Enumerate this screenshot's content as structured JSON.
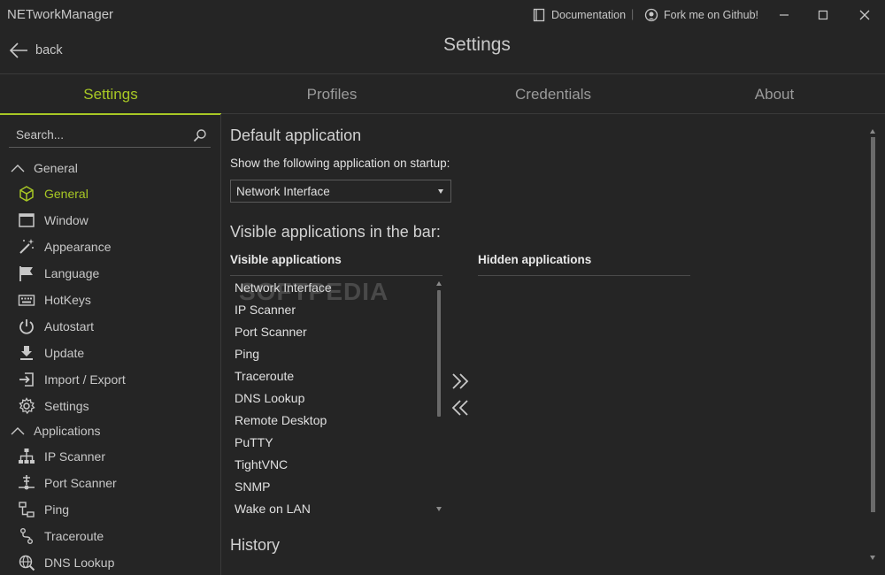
{
  "window": {
    "title": "NETworkManager",
    "documentation_label": "Documentation",
    "separator": "|",
    "github_label": "Fork me on Github!"
  },
  "header": {
    "back_label": "back",
    "title": "Settings"
  },
  "tabs": [
    {
      "label": "Settings",
      "active": true
    },
    {
      "label": "Profiles",
      "active": false
    },
    {
      "label": "Credentials",
      "active": false
    },
    {
      "label": "About",
      "active": false
    }
  ],
  "sidebar": {
    "search_placeholder": "Search...",
    "groups": [
      {
        "label": "General",
        "items": [
          {
            "label": "General",
            "icon": "cube-icon",
            "active": true
          },
          {
            "label": "Window",
            "icon": "window-icon"
          },
          {
            "label": "Appearance",
            "icon": "magic-wand-icon"
          },
          {
            "label": "Language",
            "icon": "flag-icon"
          },
          {
            "label": "HotKeys",
            "icon": "keyboard-icon"
          },
          {
            "label": "Autostart",
            "icon": "power-icon"
          },
          {
            "label": "Update",
            "icon": "download-icon"
          },
          {
            "label": "Import / Export",
            "icon": "import-icon"
          },
          {
            "label": "Settings",
            "icon": "gear-icon"
          }
        ]
      },
      {
        "label": "Applications",
        "items": [
          {
            "label": "IP Scanner",
            "icon": "network-tree-icon"
          },
          {
            "label": "Port Scanner",
            "icon": "port-icon"
          },
          {
            "label": "Ping",
            "icon": "ping-icon"
          },
          {
            "label": "Traceroute",
            "icon": "route-icon"
          },
          {
            "label": "DNS Lookup",
            "icon": "globe-search-icon"
          }
        ]
      }
    ]
  },
  "main": {
    "default_app": {
      "heading": "Default application",
      "startup_label": "Show the following application on startup:",
      "startup_value": "Network Interface"
    },
    "visible_apps": {
      "heading": "Visible applications in the bar:",
      "visible_header": "Visible applications",
      "hidden_header": "Hidden applications",
      "visible_items": [
        "Network Interface",
        "IP Scanner",
        "Port Scanner",
        "Ping",
        "Traceroute",
        "DNS Lookup",
        "Remote Desktop",
        "PuTTY",
        "TightVNC",
        "SNMP",
        "Wake on LAN"
      ],
      "hidden_items": []
    },
    "history_heading": "History"
  },
  "watermark": "SOFTPEDIA",
  "colors": {
    "accent": "#a8c825",
    "background": "#252525",
    "text": "#c8c8c8"
  }
}
